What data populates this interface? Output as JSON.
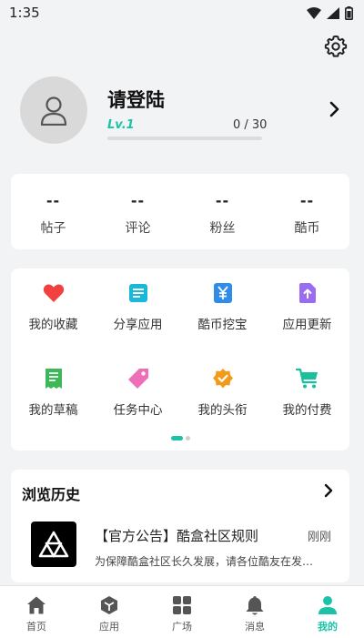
{
  "status_bar": {
    "time": "1:35"
  },
  "profile": {
    "title": "请登陆",
    "level": "Lv.1",
    "progress_text": "0 / 30",
    "progress_fraction": 0.0
  },
  "stats": [
    {
      "value": "--",
      "label": "帖子"
    },
    {
      "value": "--",
      "label": "评论"
    },
    {
      "value": "--",
      "label": "粉丝"
    },
    {
      "value": "--",
      "label": "酷币"
    }
  ],
  "features": [
    {
      "label": "我的收藏",
      "icon": "heart-icon",
      "color": "#f0413e"
    },
    {
      "label": "分享应用",
      "icon": "share-app-icon",
      "color": "#18b8d8"
    },
    {
      "label": "酷币挖宝",
      "icon": "coin-treasure-icon",
      "color": "#2f8ce8"
    },
    {
      "label": "应用更新",
      "icon": "update-icon",
      "color": "#9a6cf0"
    },
    {
      "label": "我的草稿",
      "icon": "draft-icon",
      "color": "#3db757"
    },
    {
      "label": "任务中心",
      "icon": "tag-icon",
      "color": "#ee6fb8"
    },
    {
      "label": "我的头衔",
      "icon": "badge-icon",
      "color": "#f39a1a"
    },
    {
      "label": "我的付费",
      "icon": "cart-icon",
      "color": "#1bbf9c"
    }
  ],
  "history": {
    "title": "浏览历史",
    "item": {
      "title": "【官方公告】酷盒社区规则",
      "time": "刚刚",
      "desc": "为保障酷盒社区长久发展，请各位酷友在发…"
    }
  },
  "nav": [
    {
      "label": "首页",
      "icon": "home-icon",
      "active": false
    },
    {
      "label": "应用",
      "icon": "apps-icon",
      "active": false
    },
    {
      "label": "广场",
      "icon": "square-icon",
      "active": false
    },
    {
      "label": "消息",
      "icon": "bell-icon",
      "active": false
    },
    {
      "label": "我的",
      "icon": "person-icon",
      "active": true
    }
  ],
  "colors": {
    "accent": "#19c3a8",
    "background": "#f2f3f5",
    "card": "#ffffff"
  }
}
